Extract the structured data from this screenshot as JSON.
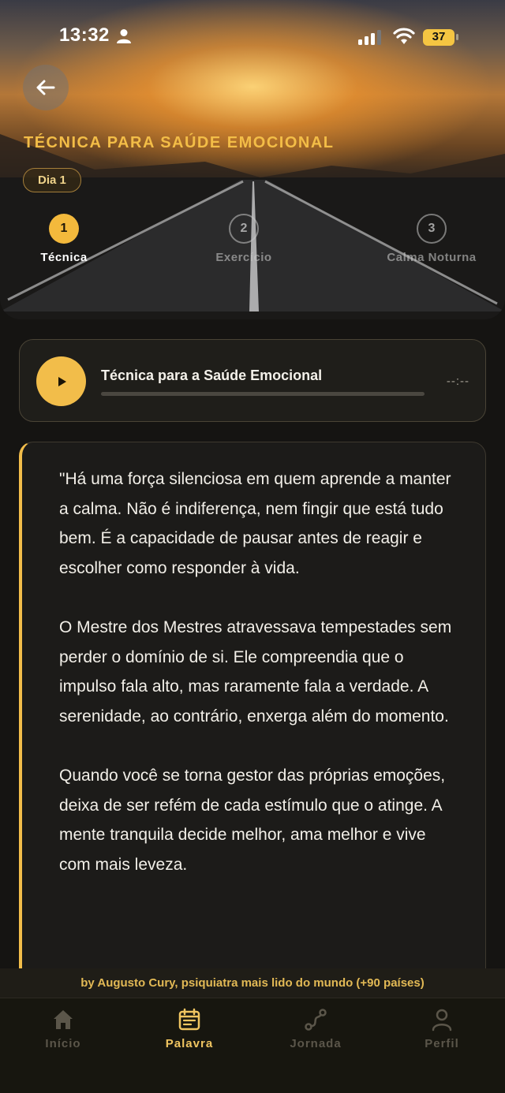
{
  "status_bar": {
    "time": "13:32",
    "battery": "37"
  },
  "header": {
    "title": "TÉCNICA PARA SAÚDE EMOCIONAL",
    "day_badge": "Dia 1"
  },
  "steps": [
    {
      "number": "1",
      "label": "Técnica",
      "active": true
    },
    {
      "number": "2",
      "label": "Exercício",
      "active": false
    },
    {
      "number": "3",
      "label": "Calma Noturna",
      "active": false
    }
  ],
  "audio": {
    "title": "Técnica para a Saúde Emocional",
    "time": "--:--",
    "progress": 0
  },
  "quote": {
    "paragraphs": [
      "\"Há uma força silenciosa em quem aprende a manter a calma. Não é indiferença, nem fingir que está tudo bem. É a capacidade de pausar antes de reagir e escolher como responder à vida.",
      "O Mestre dos Mestres atravessava tempestades sem perder o domínio de si. Ele compreendia que o impulso fala alto, mas raramente fala a verdade. A serenidade, ao contrário, enxerga além do momento.",
      "Quando você se torna gestor das próprias emoções, deixa de ser refém de cada estímulo que o atinge. A mente tranquila decide melhor, ama melhor e vive com mais leveza."
    ]
  },
  "attribution": "by Augusto Cury, psiquiatra mais lido do mundo (+90 países)",
  "nav": [
    {
      "label": "Início",
      "icon": "home-icon",
      "active": false
    },
    {
      "label": "Palavra",
      "icon": "calendar-icon",
      "active": true
    },
    {
      "label": "Jornada",
      "icon": "route-icon",
      "active": false
    },
    {
      "label": "Perfil",
      "icon": "user-icon",
      "active": false
    }
  ],
  "colors": {
    "accent": "#f2bd4a",
    "background": "#151412"
  }
}
